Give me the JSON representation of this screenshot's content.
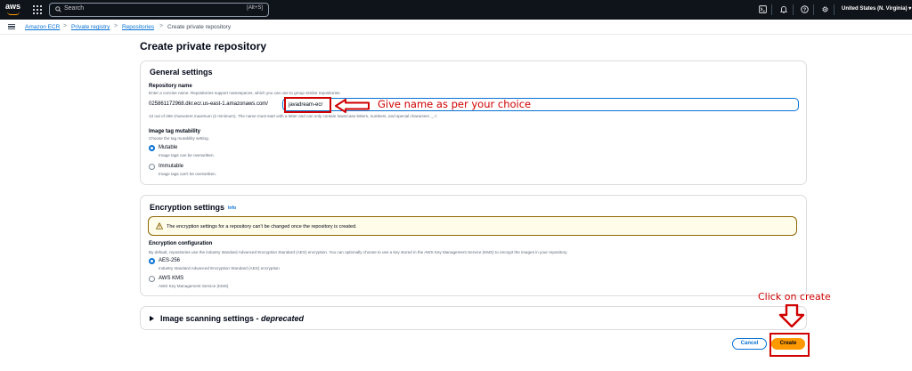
{
  "topnav": {
    "logo_text": "aws",
    "search_placeholder": "Search",
    "search_shortcut": "[Alt+S]",
    "region": "United States (N. Virginia) ▾",
    "icons": [
      "aws-logo",
      "apps-grid-icon",
      "search-icon",
      "cloudshell-icon",
      "bell-icon",
      "help-icon",
      "gear-icon"
    ]
  },
  "breadcrumb": {
    "items": [
      "Amazon ECR",
      "Private registry",
      "Repositories",
      "Create private repository"
    ],
    "separator": ">"
  },
  "page": {
    "title": "Create private repository"
  },
  "general_settings": {
    "title": "General settings",
    "repo_name_label": "Repository name",
    "repo_name_desc": "Enter a concise name. Repositories support namespaces, which you can use to group similar repositories.",
    "repo_prefix": "025861172968.dkr.ecr.us-east-1.amazonaws.com/",
    "repo_name_value": "javadream-ecr",
    "repo_name_constraint": "13 out of 256 characters maximum (2 minimum). The name must start with a letter and can only contain lowercase letters, numbers, and special characters ._-/.",
    "mutability_label": "Image tag mutability",
    "mutability_desc": "Choose the tag mutability setting.",
    "mutability_options": [
      {
        "label": "Mutable",
        "desc": "Image tags can be overwritten.",
        "selected": true
      },
      {
        "label": "Immutable",
        "desc": "Image tags can't be overwritten.",
        "selected": false
      }
    ]
  },
  "encryption_settings": {
    "title": "Encryption settings",
    "info_link": "Info",
    "alert_text": "The encryption settings for a repository can't be changed once the repository is created.",
    "config_label": "Encryption configuration",
    "config_desc": "By default, repositories use the industry standard Advanced Encryption Standard (AES) encryption. You can optionally choose to use a key stored in the AWS Key Management Service (KMS) to encrypt the images in your repository.",
    "options": [
      {
        "label": "AES-256",
        "desc": "Industry standard Advanced Encryption Standard (AES) encryption",
        "selected": true
      },
      {
        "label": "AWS KMS",
        "desc": "AWS Key Management Service (KMS)",
        "selected": false
      }
    ]
  },
  "image_scanning": {
    "title": "Image scanning settings - ",
    "title_suffix": "deprecated"
  },
  "actions": {
    "cancel_label": "Cancel",
    "create_label": "Create"
  },
  "annotations": {
    "name_hint": "Give name as per your choice",
    "create_hint": "Click on create",
    "color": "#d00000"
  },
  "colors": {
    "topnav_bg": "#0f141a",
    "link": "#0972d3",
    "primary_button": "#ff9900",
    "warning_bg": "#fffce9"
  }
}
